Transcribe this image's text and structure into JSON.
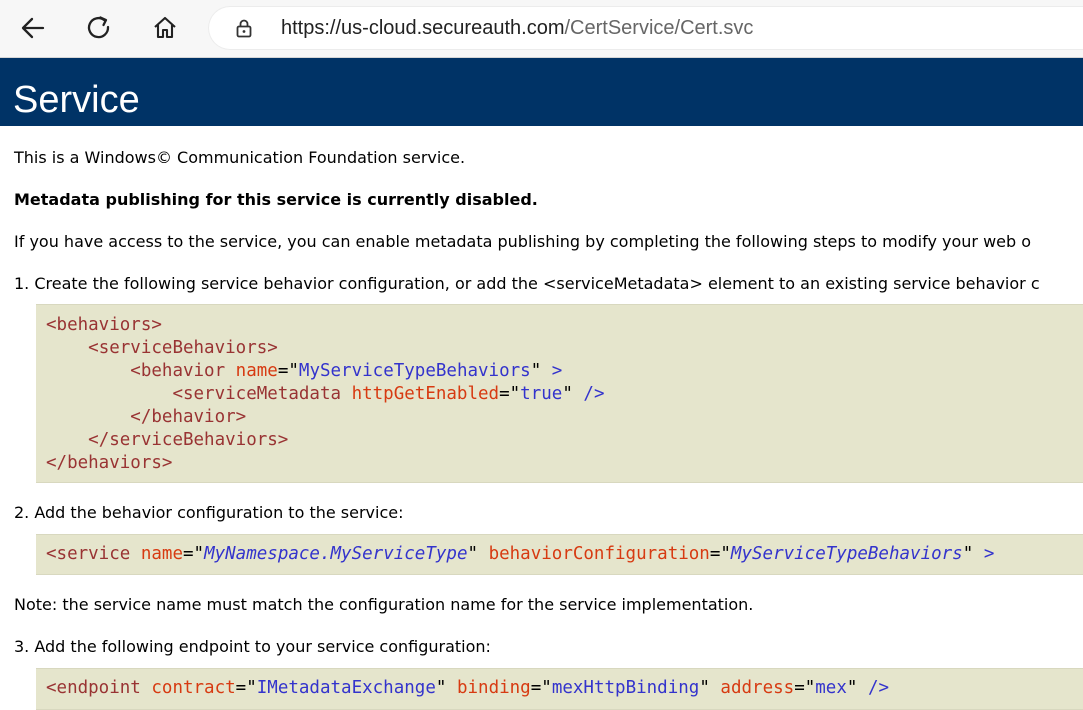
{
  "browser": {
    "url_host": "https://us-cloud.secureauth.com",
    "url_path": "/CertService/Cert.svc"
  },
  "page": {
    "title": "Service",
    "intro": "This is a Windows© Communication Foundation service.",
    "metadata_disabled": "Metadata publishing for this service is currently disabled.",
    "access_text": "If you have access to the service, you can enable metadata publishing by completing the following steps to modify your web o",
    "step1": "1. Create the following service behavior configuration, or add the <serviceMetadata> element to an existing service behavior c",
    "step2": "2. Add the behavior configuration to the service:",
    "note": "Note: the service name must match the configuration name for the service implementation.",
    "step3": "3. Add the following endpoint to your service configuration:"
  },
  "code1": {
    "l1_tag": "<behaviors>",
    "l2_tag": "<serviceBehaviors>",
    "l3_open": "<behavior",
    "l3_attr": "name",
    "l3_eq": "=\"",
    "l3_val": "MyServiceTypeBehaviors",
    "l3_end": "\"",
    "l3_close": ">",
    "l4_open": "<serviceMetadata",
    "l4_attr": "httpGetEnabled",
    "l4_eq": "=\"",
    "l4_val": "true",
    "l4_end": "\"",
    "l4_close": "/>",
    "l5_tag": "</behavior>",
    "l6_tag": "</serviceBehaviors>",
    "l7_tag": "</behaviors>"
  },
  "code2": {
    "open": "<service",
    "attr1": "name",
    "eq1": "=\"",
    "val1": "MyNamespace.MyServiceType",
    "end1": "\"",
    "attr2": "behaviorConfiguration",
    "eq2": "=\"",
    "val2": "MyServiceTypeBehaviors",
    "end2": "\"",
    "close": ">"
  },
  "code3": {
    "open": "<endpoint",
    "attr1": "contract",
    "eq1": "=\"",
    "val1": "IMetadataExchange",
    "end1": "\"",
    "attr2": "binding",
    "eq2": "=\"",
    "val2": "mexHttpBinding",
    "end2": "\"",
    "attr3": "address",
    "eq3": "=\"",
    "val3": "mex",
    "end3": "\"",
    "close": "/>"
  }
}
